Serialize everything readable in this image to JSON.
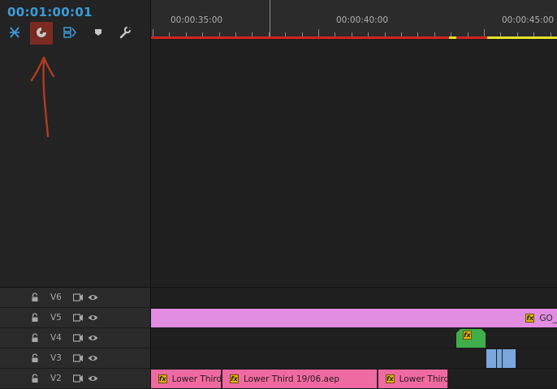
{
  "timecode": "00:01:00:01",
  "tools": [
    {
      "name": "nest-sequence-icon"
    },
    {
      "name": "snap-icon",
      "highlighted": true
    },
    {
      "name": "linked-selection-icon"
    },
    {
      "name": "add-marker-icon"
    },
    {
      "name": "timeline-settings-icon"
    }
  ],
  "ruler": {
    "labels": [
      "00:00:35:00",
      "00:00:40:00",
      "00:00:45:00"
    ]
  },
  "annotation": {
    "type": "red-arrow",
    "color": "#b03a22",
    "points_to": "snap-icon"
  },
  "tracks": [
    {
      "name": "V6"
    },
    {
      "name": "V5"
    },
    {
      "name": "V4"
    },
    {
      "name": "V3"
    },
    {
      "name": "V2"
    }
  ],
  "clips": {
    "v5": {
      "label": "GO_",
      "color": "#e38de2"
    },
    "v4": {
      "color": "#3fae4a"
    },
    "v3": {
      "color": "#7aa7dc"
    },
    "v2": [
      {
        "label": "Lower Third",
        "color": "#f06aa2"
      },
      {
        "label": "Lower Third 19/06.aep",
        "color": "#f06aa2"
      },
      {
        "label": "Lower Third",
        "color": "#f06aa2"
      }
    ]
  },
  "colors": {
    "timecode": "#3a9bd9",
    "work_area_bar": "#d2231f",
    "rendered_bar": "#e6e02a"
  }
}
